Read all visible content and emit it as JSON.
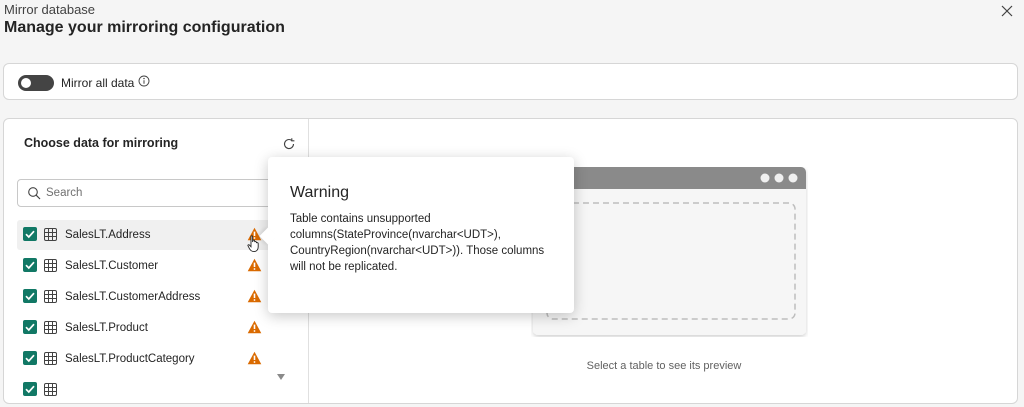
{
  "header": {
    "subtitle": "Mirror database",
    "title": "Manage your mirroring configuration",
    "close_icon": "close-icon"
  },
  "mirror_all": {
    "label": "Mirror all data",
    "enabled": false,
    "info_icon": "info-icon"
  },
  "left_pane": {
    "title": "Choose data for mirroring",
    "refresh_icon": "refresh-icon",
    "search": {
      "placeholder": "Search",
      "value": ""
    },
    "tables": [
      {
        "label": "SalesLT.Address",
        "checked": true,
        "warning": true
      },
      {
        "label": "SalesLT.Customer",
        "checked": true,
        "warning": true
      },
      {
        "label": "SalesLT.CustomerAddress",
        "checked": true,
        "warning": true
      },
      {
        "label": "SalesLT.Product",
        "checked": true,
        "warning": true
      },
      {
        "label": "SalesLT.ProductCategory",
        "checked": true,
        "warning": true
      },
      {
        "label": "",
        "checked": true,
        "warning": false
      }
    ]
  },
  "preview": {
    "empty_text": "Select a table to see its preview"
  },
  "tooltip": {
    "title": "Warning",
    "body": "Table contains unsupported columns(StateProvince(nvarchar<UDT>), CountryRegion(nvarchar<UDT>)). Those columns will not be replicated."
  },
  "colors": {
    "accent": "#117865",
    "warning": "#da6a00",
    "toggle_off": "#444444"
  }
}
